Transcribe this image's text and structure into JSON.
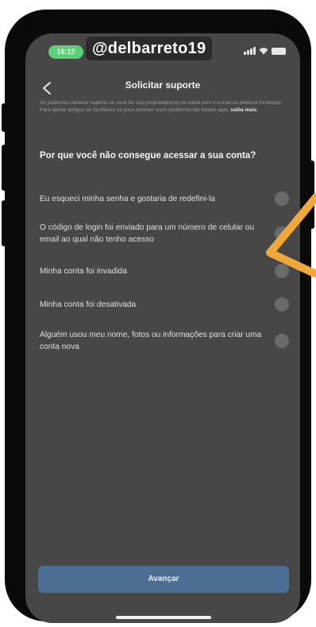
{
  "status": {
    "time": "16:12",
    "handle": "@delbarreto19"
  },
  "header": {
    "title": "Solicitar suporte",
    "intro_text": "Só podemos oferecer suporte se você for o(a) proprietário(a) da conta com o e-mail ou telefone fornecido. Para ajudar amigos ou familiares ou para resolver outro problema não listado aqui,",
    "intro_link": "saiba mais"
  },
  "question": "Por que você não consegue acessar a sua conta?",
  "options": [
    {
      "label": "Eu esqueci minha senha e gostaria de redefini-la"
    },
    {
      "label": "O código de login foi enviado para um número de celular ou email ao qual não tenho acesso"
    },
    {
      "label": "Minha conta foi invadida"
    },
    {
      "label": "Minha conta foi desativada"
    },
    {
      "label": "Alguém usou meu nome, fotos ou informações para criar uma conta nova"
    }
  ],
  "footer": {
    "continue_label": "Avançar"
  },
  "colors": {
    "background": "#474747",
    "button": "#4c6e93",
    "arrow_annotation": "#f1a83a",
    "time_pill": "#5fcf7a"
  }
}
